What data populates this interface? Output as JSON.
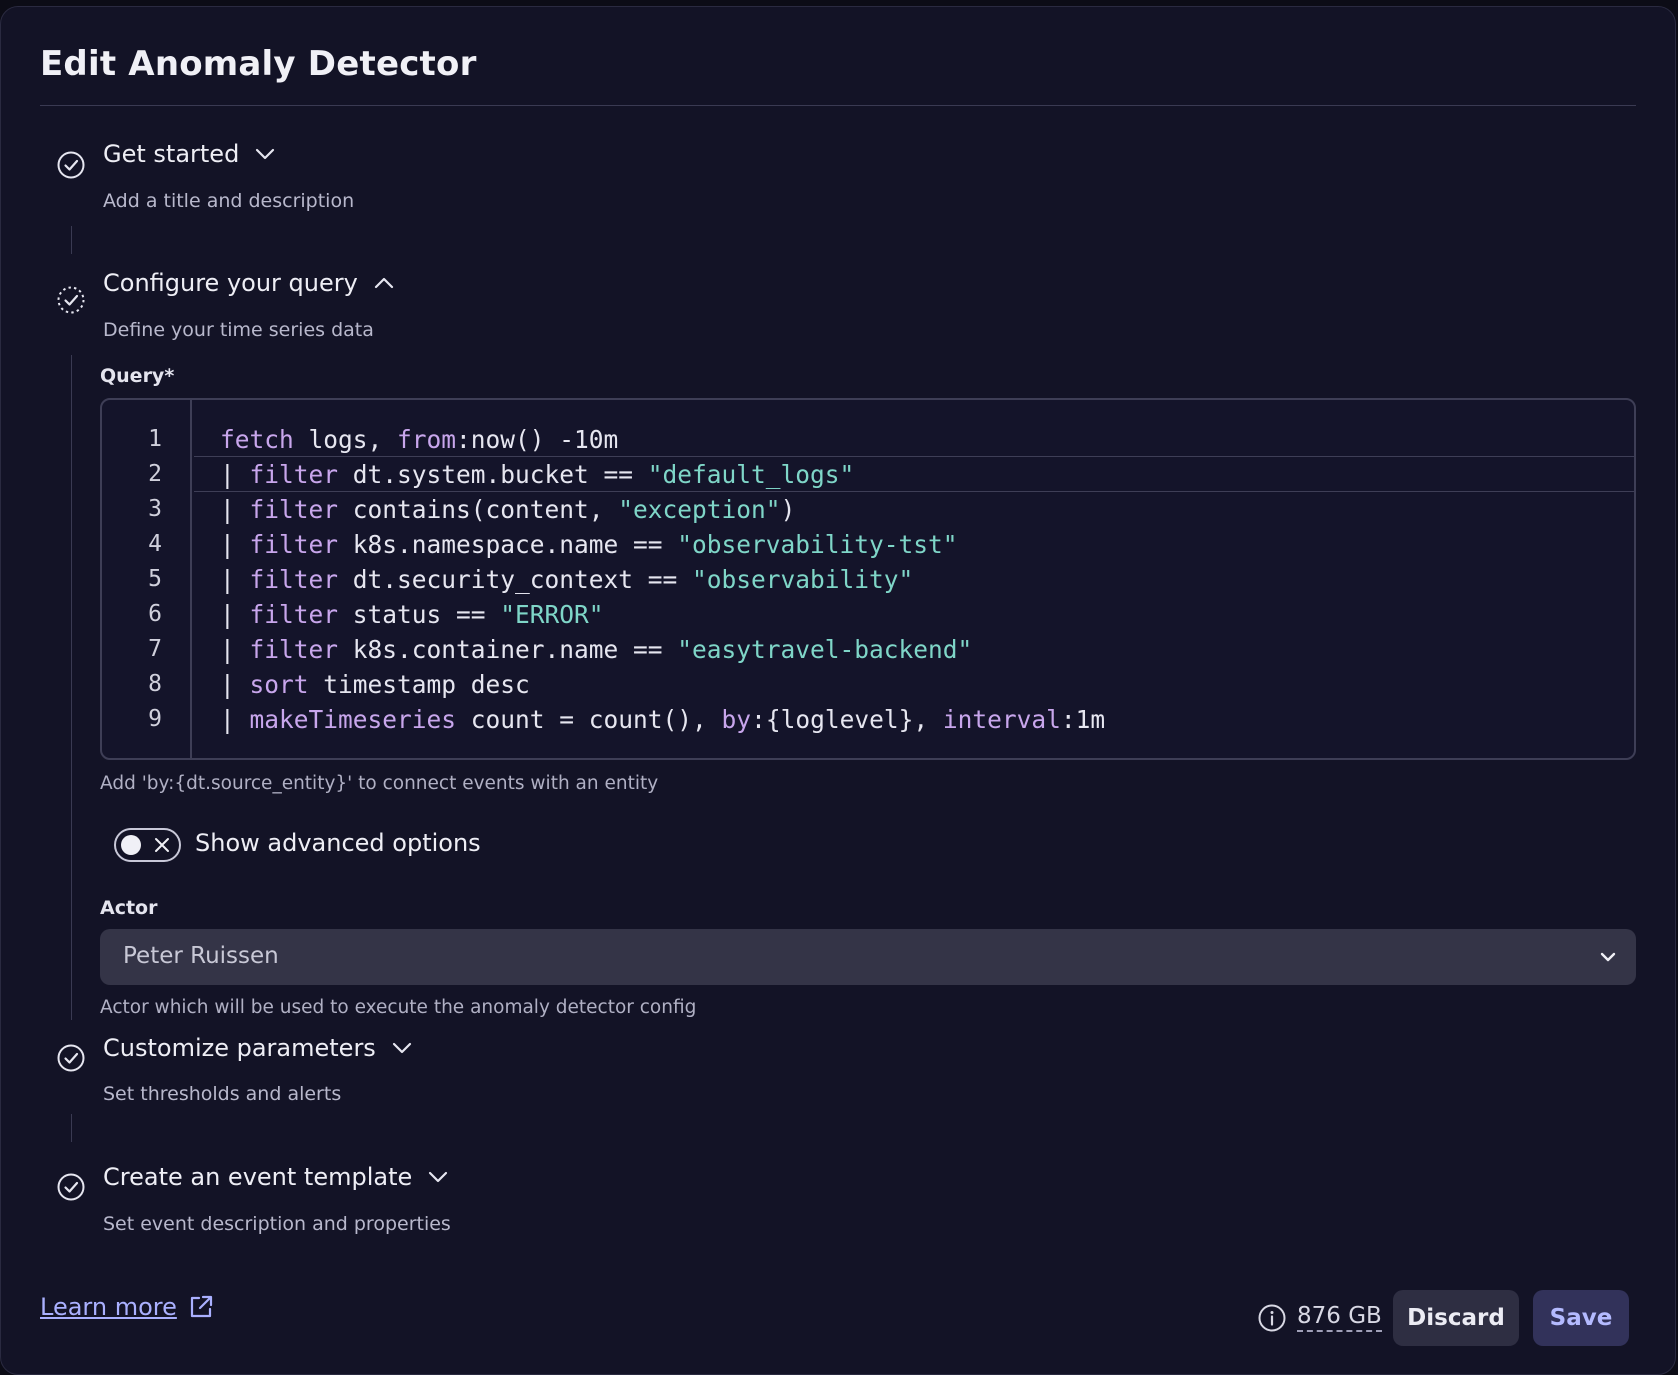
{
  "dialog": {
    "title": "Edit Anomaly Detector"
  },
  "steps": [
    {
      "title": "Get started",
      "subtitle": "Add a title and description",
      "status": "complete",
      "expanded": false
    },
    {
      "title": "Configure your query",
      "subtitle": "Define your time series data",
      "status": "in-progress",
      "expanded": true
    },
    {
      "title": "Customize parameters",
      "subtitle": "Set thresholds and alerts",
      "status": "complete",
      "expanded": false
    },
    {
      "title": "Create an event template",
      "subtitle": "Set event description and properties",
      "status": "complete",
      "expanded": false
    }
  ],
  "query": {
    "label": "Query*",
    "lines": [
      {
        "num": "1",
        "tokens": [
          [
            "kw",
            "fetch"
          ],
          [
            "t",
            " logs, "
          ],
          [
            "kw",
            "from"
          ],
          [
            "t",
            ":now() -10m"
          ]
        ]
      },
      {
        "num": "2",
        "tokens": [
          [
            "t",
            "| "
          ],
          [
            "kw",
            "filter"
          ],
          [
            "t",
            " dt.system.bucket == "
          ],
          [
            "str",
            "\"default_logs\""
          ]
        ]
      },
      {
        "num": "3",
        "tokens": [
          [
            "t",
            "| "
          ],
          [
            "kw",
            "filter"
          ],
          [
            "t",
            " contains(content, "
          ],
          [
            "str",
            "\"exception\""
          ],
          [
            "t",
            ")"
          ]
        ]
      },
      {
        "num": "4",
        "tokens": [
          [
            "t",
            "| "
          ],
          [
            "kw",
            "filter"
          ],
          [
            "t",
            " k8s.namespace.name == "
          ],
          [
            "str",
            "\"observability-tst\""
          ]
        ]
      },
      {
        "num": "5",
        "tokens": [
          [
            "t",
            "| "
          ],
          [
            "kw",
            "filter"
          ],
          [
            "t",
            " dt.security_context == "
          ],
          [
            "str",
            "\"observability\""
          ]
        ]
      },
      {
        "num": "6",
        "tokens": [
          [
            "t",
            "| "
          ],
          [
            "kw",
            "filter"
          ],
          [
            "t",
            " status == "
          ],
          [
            "str",
            "\"ERROR\""
          ]
        ]
      },
      {
        "num": "7",
        "tokens": [
          [
            "t",
            "| "
          ],
          [
            "kw",
            "filter"
          ],
          [
            "t",
            " k8s.container.name == "
          ],
          [
            "str",
            "\"easytravel-backend\""
          ]
        ]
      },
      {
        "num": "8",
        "tokens": [
          [
            "t",
            "| "
          ],
          [
            "kw",
            "sort"
          ],
          [
            "t",
            " timestamp desc"
          ]
        ]
      },
      {
        "num": "9",
        "tokens": [
          [
            "t",
            "| "
          ],
          [
            "kw",
            "makeTimeseries"
          ],
          [
            "t",
            " count = count(), "
          ],
          [
            "kw",
            "by"
          ],
          [
            "t",
            ":{loglevel}, "
          ],
          [
            "kw",
            "interval"
          ],
          [
            "t",
            ":1m"
          ]
        ]
      }
    ],
    "hint": "Add 'by:{dt.source_entity}' to connect events with an entity"
  },
  "advanced": {
    "label": "Show advanced options",
    "enabled": false
  },
  "actor": {
    "label": "Actor",
    "value": "Peter Ruissen",
    "hint": "Actor which will be used to execute the anomaly detector config"
  },
  "footer": {
    "learn_more": "Learn more",
    "size": "876 GB",
    "discard_label": "Discard",
    "save_label": "Save"
  },
  "colors": {
    "accent": "#aab0ff",
    "keyword": "#c8a6ec",
    "string": "#7fd6c8",
    "background": "#131326"
  }
}
